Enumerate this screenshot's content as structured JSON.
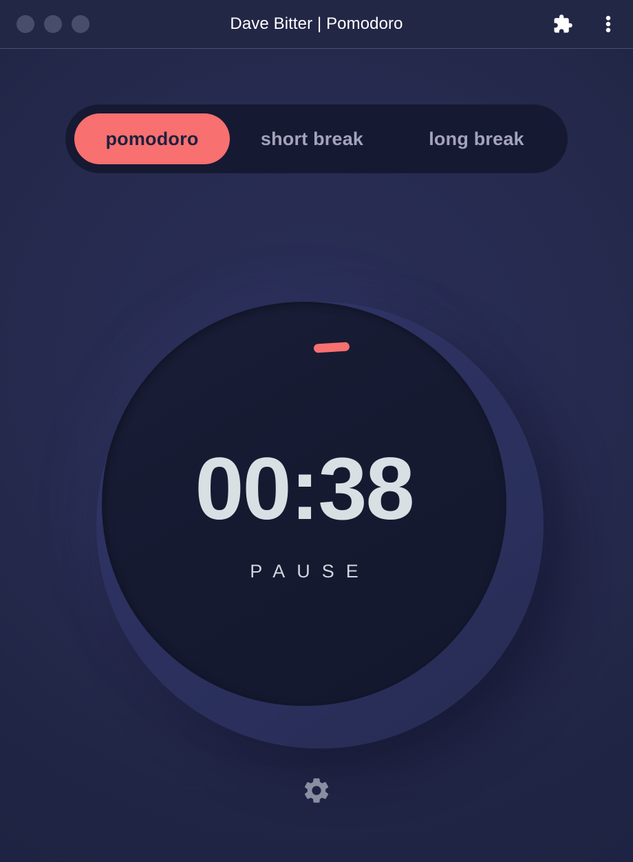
{
  "window": {
    "title": "Dave Bitter | Pomodoro",
    "traffic_lights": [
      "close",
      "minimize",
      "maximize"
    ],
    "actions": [
      {
        "name": "extensions-icon",
        "label": "Extensions"
      },
      {
        "name": "kebab-menu-icon",
        "label": "More"
      }
    ]
  },
  "tabs": {
    "items": [
      {
        "label": "pomodoro",
        "active": true
      },
      {
        "label": "short break",
        "active": false
      },
      {
        "label": "long break",
        "active": false
      }
    ]
  },
  "timer": {
    "time": "00:38",
    "action_label": "PAUSE",
    "state": "running",
    "mode": "pomodoro",
    "progress_tick_angle_deg": -3.5
  },
  "footer": {
    "settings_label": "Settings"
  },
  "colors": {
    "accent": "#f87070",
    "page_background": "#222646",
    "tabbar_background": "#161932",
    "dial_inner": "#161a31",
    "dial_outer": "#2c3160",
    "active_tab_text": "#1e213f",
    "inactive_tab_text": "#a3a3ba",
    "timer_text": "#d8e0e4",
    "titlebar_text": "#ffffff",
    "traffic_light": "#484d6b",
    "gear_icon": "#8a8ea1"
  }
}
